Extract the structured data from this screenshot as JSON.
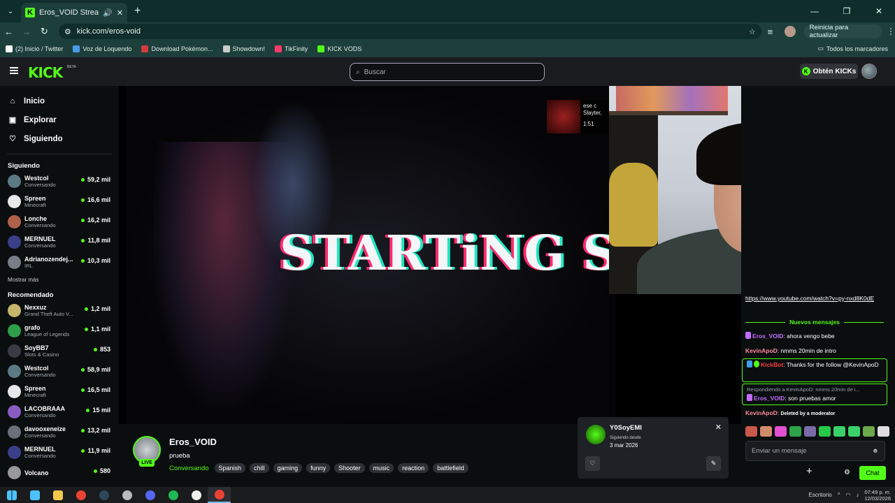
{
  "browser": {
    "tab_title": "Eros_VOID Stream - Watch",
    "tab_favicon": "K",
    "url": "kick.com/eros-void",
    "update_label": "Reinicia para actualizar",
    "bookmarks": [
      {
        "label": "(2) Inicio / Twitter",
        "color": "#ffffff"
      },
      {
        "label": "Voz de Loquendo",
        "color": "#4a9be8"
      },
      {
        "label": "Download Pokémon...",
        "color": "#d23c3c"
      },
      {
        "label": "Showdown!",
        "color": "#cccccc"
      },
      {
        "label": "TikFinity",
        "color": "#ff3b6b"
      },
      {
        "label": "KICK VODS",
        "color": "#53fc18"
      }
    ],
    "all_bookmarks": "Todos los marcadores"
  },
  "header": {
    "logo": "KICK",
    "logo_badge": "BETA",
    "search_placeholder": "Buscar",
    "kicks_label": "Obtén KICKs",
    "kicks_icon": "K"
  },
  "sidebar": {
    "nav": [
      {
        "label": "Inicio",
        "icon": "⌂"
      },
      {
        "label": "Explorar",
        "icon": "▣"
      },
      {
        "label": "Siguiendo",
        "icon": "♡"
      }
    ],
    "following_title": "Siguiendo",
    "following": [
      {
        "name": "Westcol",
        "category": "Conversando",
        "viewers": "59,2 mil",
        "color": "#5c7a84"
      },
      {
        "name": "Spreen",
        "category": "Minecraft",
        "viewers": "16,6 mil",
        "color": "#e8e8e8"
      },
      {
        "name": "Lonche",
        "category": "Conversando",
        "viewers": "16,2 mil",
        "color": "#b0614a"
      },
      {
        "name": "MERNUEL",
        "category": "Conversando",
        "viewers": "11,8 mil",
        "color": "#3a3f8a"
      },
      {
        "name": "Adrianozendej...",
        "category": "IRL",
        "viewers": "10,3 mil",
        "color": "#777e88"
      }
    ],
    "show_more": "Mostrar más",
    "recommended_title": "Recomendado",
    "recommended": [
      {
        "name": "Nexxuz",
        "category": "Grand Theft Auto V...",
        "viewers": "1,2 mil",
        "color": "#c7b56b"
      },
      {
        "name": "grafo",
        "category": "League of Legends",
        "viewers": "1,1 mil",
        "color": "#2e9e4a"
      },
      {
        "name": "SoyBB7",
        "category": "Slots & Casino",
        "viewers": "853",
        "color": "#3b3b45"
      },
      {
        "name": "Westcol",
        "category": "Conversando",
        "viewers": "58,9 mil",
        "color": "#5c7a84"
      },
      {
        "name": "Spreen",
        "category": "Minecraft",
        "viewers": "16,5 mil",
        "color": "#e8e8e8"
      },
      {
        "name": "LACOBRAAA",
        "category": "Conversando",
        "viewers": "15 mil",
        "color": "#8a5cc2"
      },
      {
        "name": "davooxeneize",
        "category": "Conversando",
        "viewers": "13,2 mil",
        "color": "#6a6f78"
      },
      {
        "name": "MERNUEL",
        "category": "Conversando",
        "viewers": "11,9 mil",
        "color": "#3a3f8a"
      },
      {
        "name": "Volcano",
        "category": "",
        "viewers": "580",
        "color": "#999999"
      }
    ]
  },
  "video": {
    "overlay_text": "STARTiNG SooN",
    "mini_title": "ese c",
    "mini_artist": "Slayter,",
    "mini_time": "1:51"
  },
  "stream": {
    "streamer": "Eros_VOID",
    "live_badge": "LIVE",
    "title": "prueba",
    "category": "Conversando",
    "tags": [
      "Spanish",
      "chill",
      "gaming",
      "funny",
      "Shooter",
      "music",
      "reaction",
      "battlefield"
    ]
  },
  "follow_popup": {
    "username": "Y0SoyEMI",
    "since_label": "Siguiendo desde",
    "date": "3 mar 2026"
  },
  "chat": {
    "link_text": "https://www.youtube.com/watch?v=py-nxd8K0dE",
    "new_messages": "Nuevos mensajes",
    "messages": [
      {
        "user": "Eros_VOID",
        "text": ": ahora vengo bebe"
      },
      {
        "user": "KevinApoD",
        "text": ": nmms 20min de intro"
      },
      {
        "user": "KickBot",
        "text": ": Thanks for the follow @KevinApoD"
      },
      {
        "reply": "Respondiendo a KevinApoD: nmms 20min de i...",
        "user": "Eros_VOID",
        "text": ": son pruebas amor"
      },
      {
        "user": "KevinApoD",
        "text": ": ",
        "deleted": "Deleted by a moderator"
      }
    ],
    "input_placeholder": "Enviar un mensaje",
    "send_label": "Chat",
    "emote_colors": [
      "#c9574a",
      "#d08b6a",
      "#e24fd3",
      "#2ea34a",
      "#7a6aa8",
      "#26c94a",
      "#3bd16a",
      "#3bd16a",
      "#6ba84a",
      "#dddddd"
    ]
  },
  "taskbar": {
    "desktop_label": "Escritorio",
    "time": "07:49 p. m.",
    "date": "12/03/2026",
    "apps": [
      "#4cc2ff",
      "#f2c94c",
      "#ea4335",
      "#2a475e",
      "#bbbbbb",
      "#5865f2",
      "#1db954",
      "#f0f0f0",
      "#ea4335"
    ]
  }
}
